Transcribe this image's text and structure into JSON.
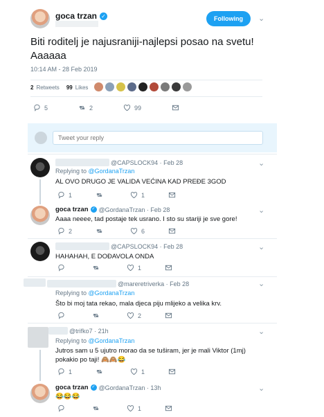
{
  "tweet": {
    "author": "goca trzan",
    "follow_label": "Following",
    "text": "Biti roditelj je najusraniji-najlepsi posao na svetu! Aaaaaa",
    "time": "10:14 AM - 28 Feb 2019",
    "retweets_count": "2",
    "retweets_label": "Retweets",
    "likes_count": "99",
    "likes_label": "Likes",
    "actions": {
      "replies": "5",
      "retweets": "2",
      "likes": "99"
    }
  },
  "composer": {
    "placeholder": "Tweet your reply"
  },
  "replies": [
    {
      "handle": "@CAPSLOCK94 · Feb 28",
      "replying_label": "Replying to",
      "replying_to": "@GordanaTrzan",
      "text": "AL OVO DRUGO JE VALIDA VEĆINA KAD PREĐE 3GOD",
      "counts": {
        "replies": "1",
        "retweets": "",
        "likes": "1"
      }
    },
    {
      "author": "goca trzan",
      "handle": "@GordanaTrzan · Feb 28",
      "text": "Aaaa neeee, tad postaje tek usrano. I sto su stariji je sve gore!",
      "counts": {
        "replies": "2",
        "retweets": "",
        "likes": "6"
      }
    },
    {
      "handle": "@CAPSLOCK94 · Feb 28",
      "text": "HAHAHAH, E DOĐAVOLA ONDA",
      "counts": {
        "replies": "",
        "retweets": "",
        "likes": "1"
      }
    },
    {
      "handle": "@mareretriverka · Feb 28",
      "replying_label": "Replying to",
      "replying_to": "@GordanaTrzan",
      "text": "Što bi moj tata rekao, mala djeca piju mlijeko a velika krv.",
      "counts": {
        "replies": "",
        "retweets": "",
        "likes": "2"
      }
    },
    {
      "handle": "@trifko7 · 21h",
      "replying_label": "Replying to",
      "replying_to": "@GordanaTrzan",
      "text": "Jutros sam u 5 ujutro morao da se tuširam, jer je mali Viktor (1mj) pokakio po taji! 🙈🙈😂",
      "counts": {
        "replies": "1",
        "retweets": "",
        "likes": "1"
      }
    },
    {
      "author": "goca trzan",
      "handle": "@GordanaTrzan · 13h",
      "text": "😂😂😂",
      "counts": {
        "replies": "",
        "retweets": "",
        "likes": "1"
      }
    }
  ],
  "colors": {
    "accent": "#1da1f2",
    "muted": "#657786",
    "divider": "#e6ecf0"
  }
}
